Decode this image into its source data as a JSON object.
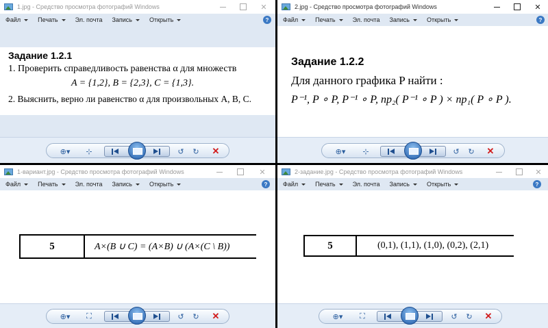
{
  "menu": {
    "file": "Файл",
    "print": "Печать",
    "email": "Эл. почта",
    "burn": "Запись",
    "open": "Открыть",
    "help": "?"
  },
  "windows": [
    {
      "title": "1.jpg - Средство просмотра фотографий Windows",
      "active": false,
      "heading": "Задание 1.2.1",
      "line1": "1. Проверить справедливость равенства α для множеств",
      "line2": "A = {1,2},  B = {2,3}, C = {1,3}.",
      "line3": "2. Выяснить, верно ли равенство α для произвольных  A,  B,  C."
    },
    {
      "title": "2.jpg - Средство просмотра фотографий Windows",
      "active": true,
      "heading": "Задание 1.2.2",
      "line1": "Для данного графика  P  найти :",
      "line2": "P⁻¹,  P ∘ P,  P⁻¹ ∘ P,  пр₂( P⁻¹ ∘ P ) × пр₁( P ∘ P )."
    },
    {
      "title": "1-вариант.jpg - Средство просмотра фотографий Windows",
      "active": false,
      "row_number": "5",
      "row_expr": "A×(B ∪ C) = (A×B) ∪ (A×(C \\ B))"
    },
    {
      "title": "2-задание.jpg - Средство просмотра фотографий Windows",
      "active": false,
      "row_number": "5",
      "row_expr": "(0,1), (1,1), (1,0), (0,2), (2,1)"
    }
  ],
  "captions": {
    "minimize": "",
    "maximize": "",
    "close": "✕"
  },
  "toolbar_icons": {
    "zoom": "⊕▾",
    "fit": "⊹",
    "actual_size": "⛶",
    "rotate_left": "↺",
    "rotate_right": "↻",
    "delete": "✕"
  },
  "colors": {
    "menubar": "#dfe8f3",
    "toolbar": "#e5edf7",
    "delete": "#d11a1a",
    "accent": "#3b79c4"
  }
}
